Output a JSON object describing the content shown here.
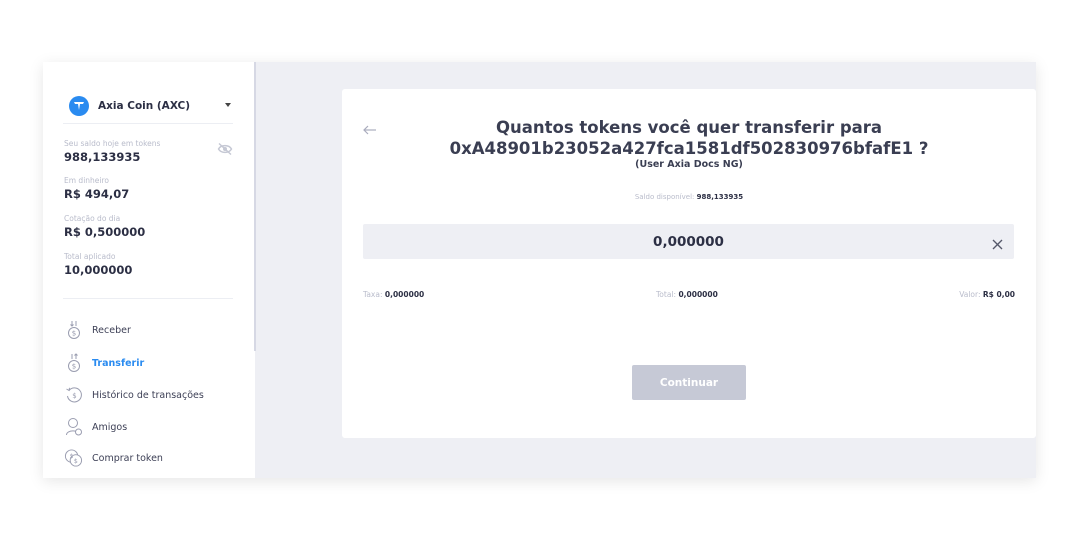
{
  "sidebar": {
    "coin": {
      "name": "Axia Coin (AXC)",
      "logo_color": "#2a8bf0"
    },
    "stats": [
      {
        "label": "Seu saldo hoje em tokens",
        "value": "988,133935"
      },
      {
        "label": "Em dinheiro",
        "value": "R$ 494,07"
      },
      {
        "label": "Cotação do dia",
        "value": "R$ 0,500000"
      },
      {
        "label": "Total aplicado",
        "value": "10,000000"
      }
    ],
    "nav": [
      {
        "label": "Receber",
        "icon": "receive-coin-icon"
      },
      {
        "label": "Transferir",
        "icon": "transfer-coin-icon",
        "active": true
      },
      {
        "label": "Histórico de transações",
        "icon": "history-coin-icon"
      },
      {
        "label": "Amigos",
        "icon": "friends-icon"
      },
      {
        "label": "Comprar token",
        "icon": "buy-token-icon"
      }
    ]
  },
  "transfer": {
    "title_line1": "Quantos tokens você quer transferir para",
    "title_line2": "0xA48901b23052a427fca1581df502830976bfafE1 ?",
    "recipient": "(User Axia Docs NG)",
    "balance_label": "Saldo disponível:",
    "balance_value": "988,133935",
    "amount": "0,000000",
    "fee_label": "Taxa:",
    "fee_value": "0,000000",
    "total_label": "Total:",
    "total_value": "0,000000",
    "value_label": "Valor:",
    "value_value": "R$ 0,00",
    "continue_label": "Continuar"
  },
  "colors": {
    "accent": "#2a8bf0",
    "panel_bg": "#eeeff4",
    "button_disabled": "#c6c9d6"
  }
}
